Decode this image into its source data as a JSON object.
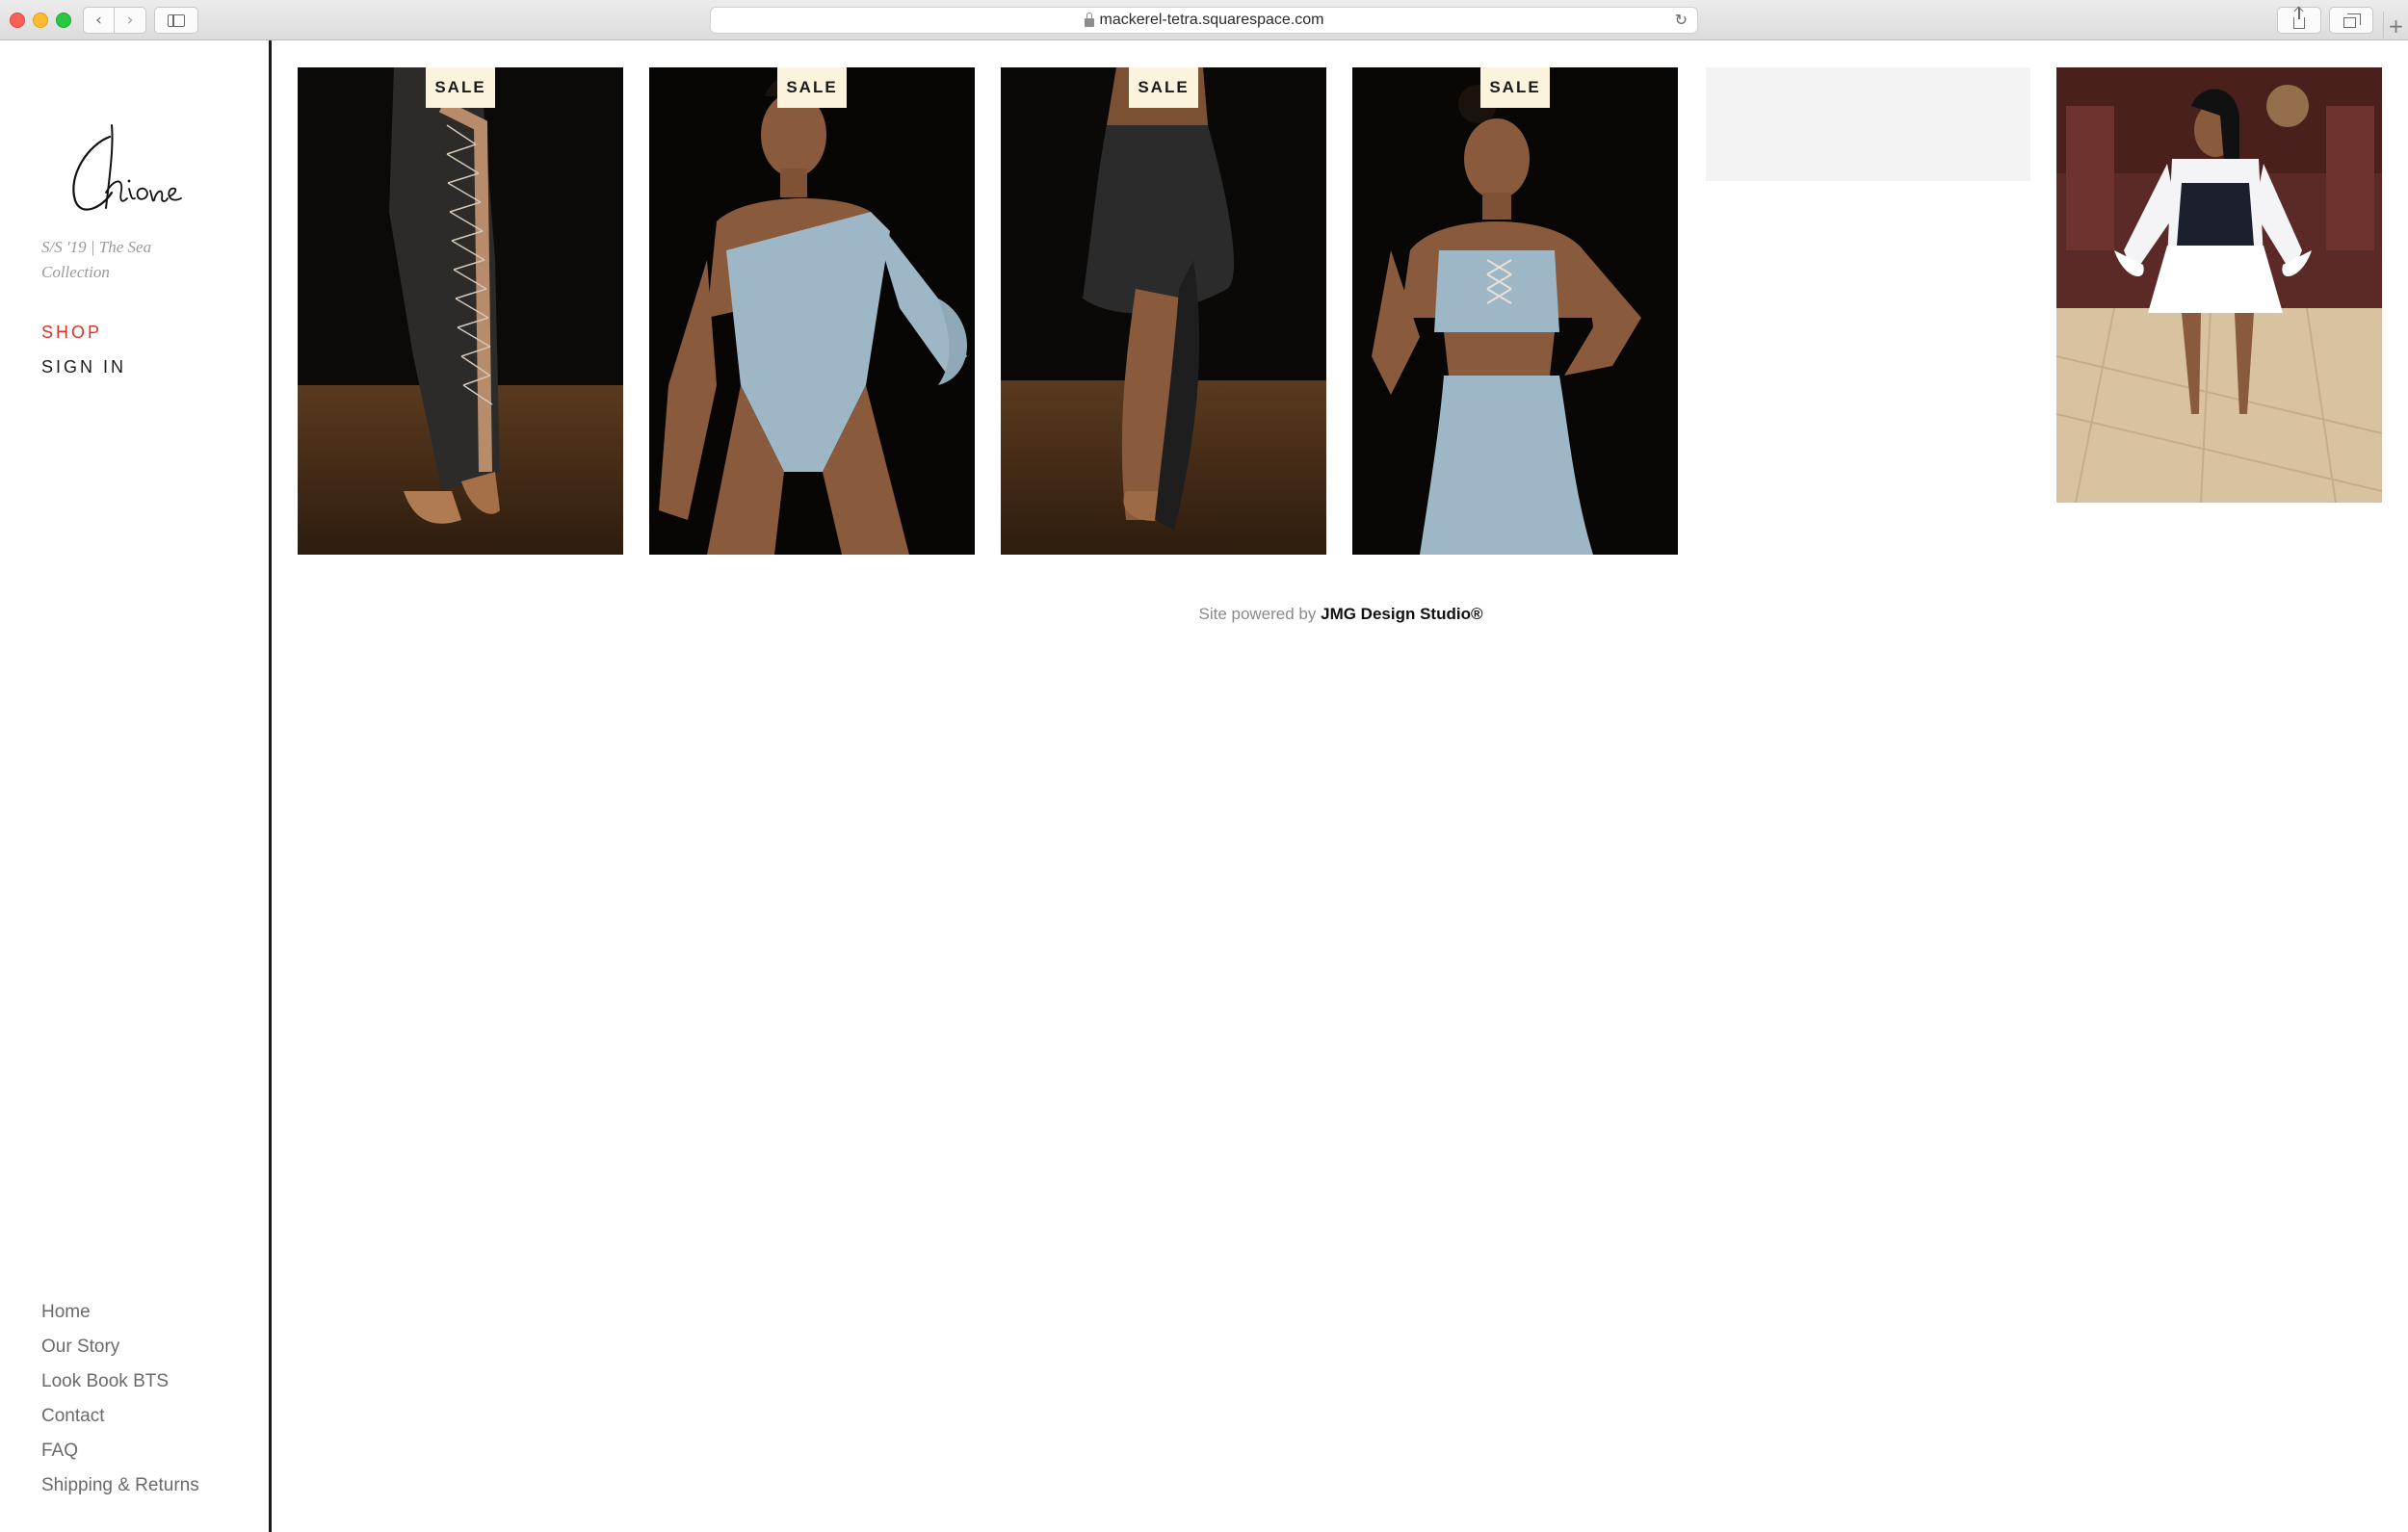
{
  "browser": {
    "url": "mackerel-tetra.squarespace.com"
  },
  "brand": {
    "logo_text": "Chione",
    "tagline": "S/S '19 | The Sea Collection"
  },
  "primary_nav": [
    {
      "label": "SHOP",
      "active": true
    },
    {
      "label": "SIGN IN",
      "active": false
    }
  ],
  "footer_nav": [
    {
      "label": "Home"
    },
    {
      "label": "Our Story"
    },
    {
      "label": "Look Book BTS"
    },
    {
      "label": "Contact"
    },
    {
      "label": "FAQ"
    },
    {
      "label": "Shipping & Returns"
    }
  ],
  "products": [
    {
      "badge": "SALE",
      "outfit_color": "#2a2a2a"
    },
    {
      "badge": "SALE",
      "outfit_color": "#9db7c6"
    },
    {
      "badge": "SALE",
      "outfit_color": "#1f1f1f"
    },
    {
      "badge": "SALE",
      "outfit_color": "#9db7c6"
    },
    {
      "badge": "",
      "outfit_color": ""
    },
    {
      "badge": "",
      "outfit_color": "#ffffff"
    }
  ],
  "footer": {
    "powered_prefix": "Site powered by ",
    "studio": "JMG Design Studio®"
  },
  "colors": {
    "accent": "#d9342b",
    "sale_badge_bg": "#fbf3dc"
  }
}
